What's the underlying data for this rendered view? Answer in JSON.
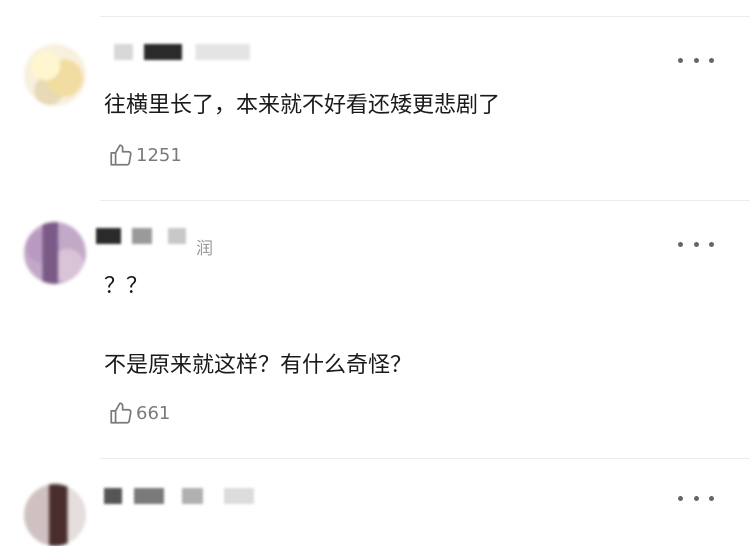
{
  "comments": [
    {
      "text_lines": [
        "往横里长了，本来就不好看还矮更悲剧了"
      ],
      "likes": "1251"
    },
    {
      "time_suffix": "润",
      "text_lines": [
        "？？",
        "不是原来就这样？有什么奇怪？"
      ],
      "likes": "661"
    }
  ],
  "icons": {
    "more": "more-dots-icon",
    "like": "thumbs-up-icon"
  }
}
